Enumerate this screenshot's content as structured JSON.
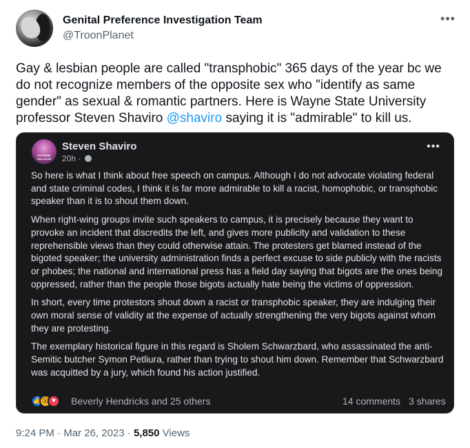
{
  "author": {
    "name": "Genital Preference Investigation Team",
    "handle": "@TroonPlanet"
  },
  "tweet": {
    "text_before_mention": "Gay & lesbian people are called \"transphobic\" 365 days of the year bc we do not recognize members of the opposite sex who \"identify as same gender\" as sexual & romantic partners. Here is Wayne State University professor Steven Shaviro ",
    "mention": "@shaviro",
    "text_after_mention": " saying it is \"admirable\" to kill us."
  },
  "embedded_post": {
    "author": "Steven Shaviro",
    "time": "20h ·",
    "avatar_label": "EXTREME HALLUCIN",
    "paragraphs": [
      "So here is what I think about free speech on campus. Although I do not advocate violating federal and state criminal codes, I think it is far more admirable to kill a racist, homophobic, or transphobic speaker than it is to shout them down.",
      "When right-wing groups invite such speakers to campus, it is precisely because they want to provoke an incident that discredits the left, and gives more publicity and validation to these reprehensible views than they could otherwise attain. The protesters get blamed instead of the bigoted speaker; the university administration finds a perfect excuse to side publicly with the racists or phobes; the national and international press has a field day saying that bigots are the ones being oppressed, rather than the people those bigots actually hate being the victims of oppression.",
      "In short, every time protestors shout down a racist or transphobic speaker, they are indulging their own moral sense of validity at the expense of actually strengthening the very bigots against whom they are protesting.",
      "The exemplary historical figure in this regard is Sholem Schwarzbard, who assassinated the anti-Semitic butcher Symon Petliura, rather than trying to shout him down. Remember that Schwarzbard was acquitted by a jury, which found his action justified."
    ],
    "reactions_text": "Beverly Hendricks and 25 others",
    "comments": "14 comments",
    "shares": "3 shares"
  },
  "meta": {
    "time": "9:24 PM",
    "separator": "·",
    "date": "Mar 26, 2023",
    "views_count": "5,850",
    "views_label": "Views"
  },
  "icons": {
    "more": "more-horizontal-icon",
    "reaction_like": "like-reaction-icon",
    "reaction_wow": "wow-reaction-icon",
    "reaction_love": "love-reaction-icon",
    "globe": "globe-icon"
  },
  "colors": {
    "link": "#1d9bf0",
    "card_bg": "#18191a",
    "secondary_text": "#536471"
  }
}
